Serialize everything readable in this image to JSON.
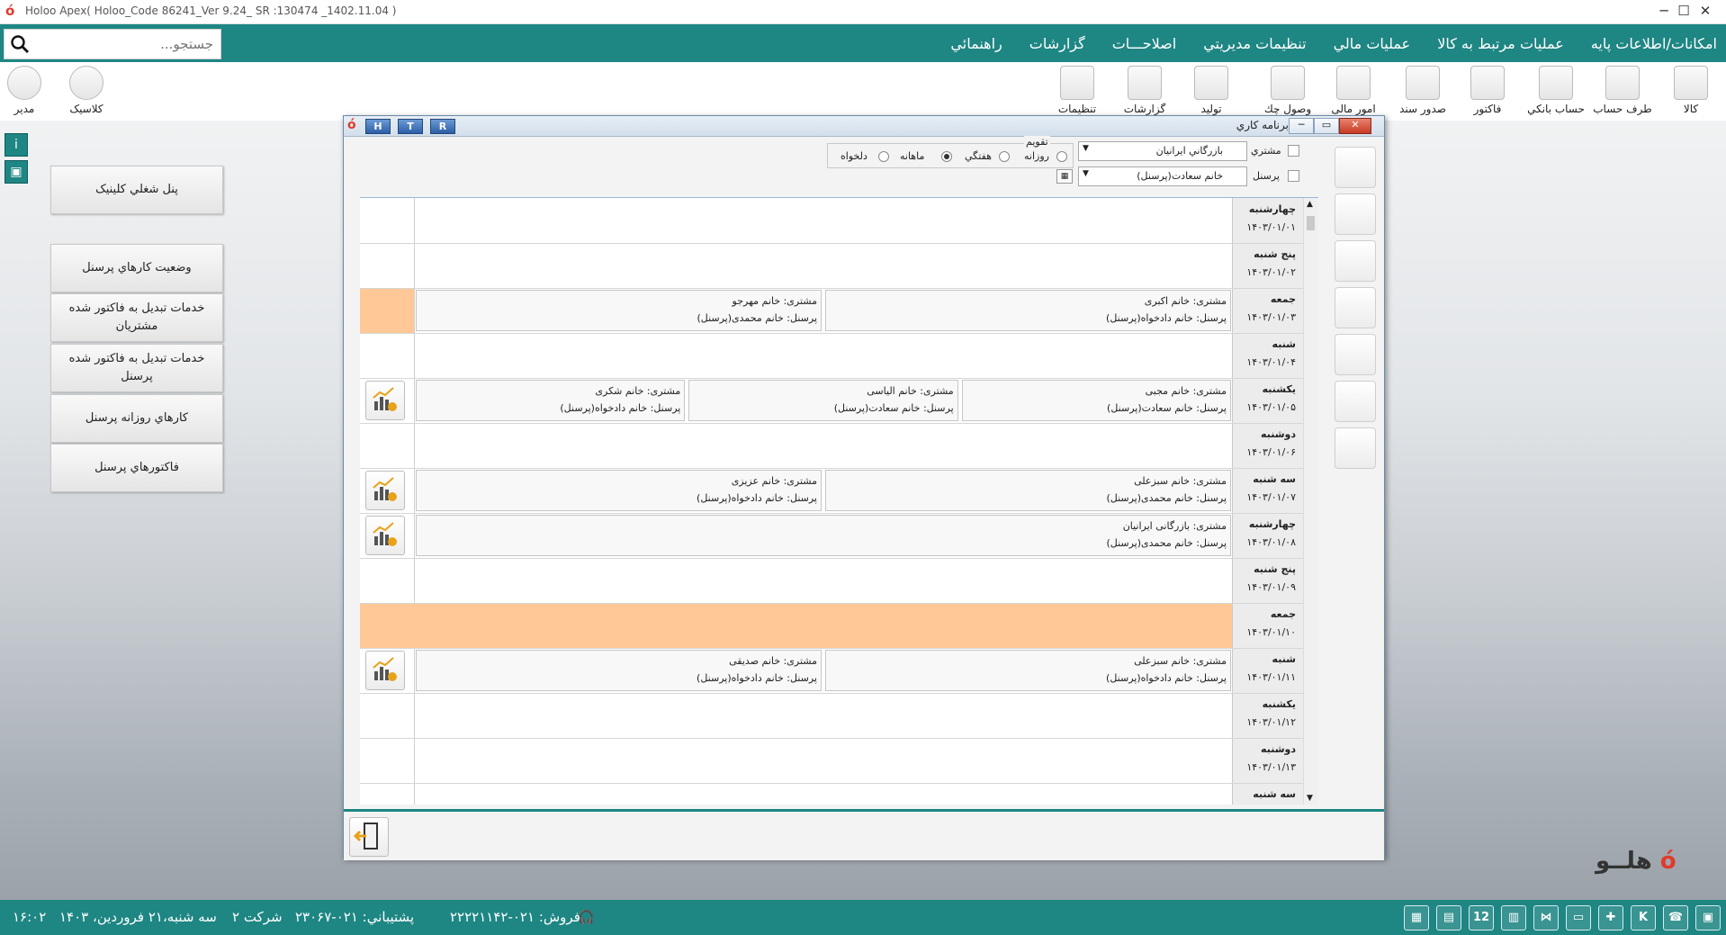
{
  "window": {
    "title": "Holoo Apex( Holoo_Code  86241_Ver 9.24_ SR :130474 _1402.11.04 )",
    "controls": [
      "─",
      "☐",
      "✕"
    ]
  },
  "search": {
    "placeholder": "جستجو..."
  },
  "menu": [
    "امکانات/اطلاعات پايه",
    "عمليات مرتبط به کالا",
    "عمليات مالي",
    "تنظيمات مديريتي",
    "اصلاحـــات",
    "گزارشات",
    "راهنمائي"
  ],
  "toolbar": {
    "right": [
      {
        "label": "کالا",
        "icon": "box-icon"
      },
      {
        "label": "طرف حساب",
        "icon": "person-account-icon"
      },
      {
        "label": "حساب بانکي",
        "icon": "bank-icon"
      },
      {
        "label": "فاکتور",
        "icon": "invoice-icon"
      },
      {
        "label": "صدور سند",
        "icon": "document-icon"
      },
      {
        "label": "امور مالی",
        "icon": "finance-icon"
      },
      {
        "label": "وصول چك",
        "icon": "cheque-icon"
      },
      {
        "label": "تولید",
        "icon": "production-icon"
      },
      {
        "label": "گزارشات",
        "icon": "reports-icon"
      },
      {
        "label": "تنظیمات",
        "icon": "settings-icon"
      }
    ],
    "left": [
      {
        "label": "کلاسیک",
        "icon": "palette-icon"
      },
      {
        "label": "مدير",
        "icon": "user-icon"
      }
    ]
  },
  "left_panel": {
    "buttons": [
      "پنل شغلي کلينيک",
      "وضعيت کارهاي پرسنل",
      "خدمات تبدیل به فاکتور شده مشتریان",
      "خدمات تبدیل به فاکتور شده پرسنل",
      "کارهاي روزانه پرسنل",
      "فاکتورهاي پرسنل"
    ]
  },
  "dialog": {
    "title": "برنامه کاري",
    "header_buttons": [
      "H",
      "T",
      "R"
    ],
    "filters": {
      "customer_label": "مشتري",
      "customer_value": "بازرگاني ايرانيان",
      "personnel_label": "پرسنل",
      "personnel_value": "خانم سعادت(پرسنل)",
      "calendar_label": "تقويم",
      "radios": [
        {
          "label": "روزانه",
          "checked": false
        },
        {
          "label": "هفتگي",
          "checked": true
        },
        {
          "label": "ماهانه",
          "checked": false
        },
        {
          "label": "دلخواه",
          "checked": false
        }
      ]
    },
    "days": [
      {
        "name": "چهارشنبه",
        "date": "۱۴۰۳/۰۱/۰۱",
        "highlight": false,
        "report_button": false,
        "events": []
      },
      {
        "name": "پنج شنبه",
        "date": "۱۴۰۳/۰۱/۰۲",
        "highlight": false,
        "report_button": false,
        "events": []
      },
      {
        "name": "جمعه",
        "date": "۱۴۰۳/۰۱/۰۳",
        "highlight": false,
        "orange_left": true,
        "report_button": false,
        "events": [
          {
            "customer": "مشتری: خانم اکبری",
            "personnel": "پرسنل: خانم دادخواه(پرسنل)"
          },
          {
            "customer": "مشتری: خانم مهرجو",
            "personnel": "پرسنل: خانم محمدی(پرسنل)"
          }
        ]
      },
      {
        "name": "شنبه",
        "date": "۱۴۰۳/۰۱/۰۴",
        "highlight": false,
        "report_button": false,
        "events": []
      },
      {
        "name": "يکشنبه",
        "date": "۱۴۰۳/۰۱/۰۵",
        "highlight": false,
        "report_button": true,
        "events": [
          {
            "customer": "مشتری: خانم مجبی",
            "personnel": "پرسنل: خانم سعادت(پرسنل)"
          },
          {
            "customer": "مشتری: خانم الیاسی",
            "personnel": "پرسنل: خانم سعادت(پرسنل)"
          },
          {
            "customer": "مشتری: خانم شکری",
            "personnel": "پرسنل: خانم دادخواه(پرسنل)"
          }
        ]
      },
      {
        "name": "دوشنبه",
        "date": "۱۴۰۳/۰۱/۰۶",
        "highlight": false,
        "report_button": false,
        "events": []
      },
      {
        "name": "سه شنبه",
        "date": "۱۴۰۳/۰۱/۰۷",
        "highlight": false,
        "report_button": true,
        "events": [
          {
            "customer": "مشتری: خانم سبزعلی",
            "personnel": "پرسنل: خانم محمدی(پرسنل)"
          },
          {
            "customer": "مشتری: خانم عزیزی",
            "personnel": "پرسنل: خانم دادخواه(پرسنل)"
          }
        ]
      },
      {
        "name": "چهارشنبه",
        "date": "۱۴۰۳/۰۱/۰۸",
        "highlight": false,
        "report_button": true,
        "events": [
          {
            "customer": "مشتری: بازرگانی ایرانیان",
            "personnel": "پرسنل: خانم محمدی(پرسنل)"
          }
        ]
      },
      {
        "name": "پنج شنبه",
        "date": "۱۴۰۳/۰۱/۰۹",
        "highlight": false,
        "report_button": false,
        "events": []
      },
      {
        "name": "جمعه",
        "date": "۱۴۰۳/۰۱/۱۰",
        "highlight": true,
        "report_button": false,
        "events": []
      },
      {
        "name": "شنبه",
        "date": "۱۴۰۳/۰۱/۱۱",
        "highlight": false,
        "report_button": true,
        "events": [
          {
            "customer": "مشتری: خانم سبزعلی",
            "personnel": "پرسنل: خانم دادخواه(پرسنل)"
          },
          {
            "customer": "مشتری: خانم صدیقی",
            "personnel": "پرسنل: خانم دادخواه(پرسنل)"
          }
        ]
      },
      {
        "name": "يکشنبه",
        "date": "۱۴۰۳/۰۱/۱۲",
        "highlight": false,
        "report_button": false,
        "events": []
      },
      {
        "name": "دوشنبه",
        "date": "۱۴۰۳/۰۱/۱۳",
        "highlight": false,
        "report_button": false,
        "events": []
      },
      {
        "name": "سه شنبه",
        "date": "",
        "highlight": false,
        "report_button": false,
        "events": []
      }
    ]
  },
  "brand": "هلــو",
  "status": {
    "time": "۱۶:۰۲",
    "date": "سه شنبه،۲۱ فروردين، ۱۴۰۳",
    "company": "شرکت ۲",
    "support": "پشتيباني: ۰۲۱-۲۳۰۶۷",
    "sales": "فروش: ۰۲۱-۲۲۲۲۱۱۴۲",
    "tray_badges": [
      "K",
      "12"
    ]
  },
  "colors": {
    "teal": "#1e8683",
    "highlight": "#ffc896",
    "accent_red": "#e03a2a"
  }
}
